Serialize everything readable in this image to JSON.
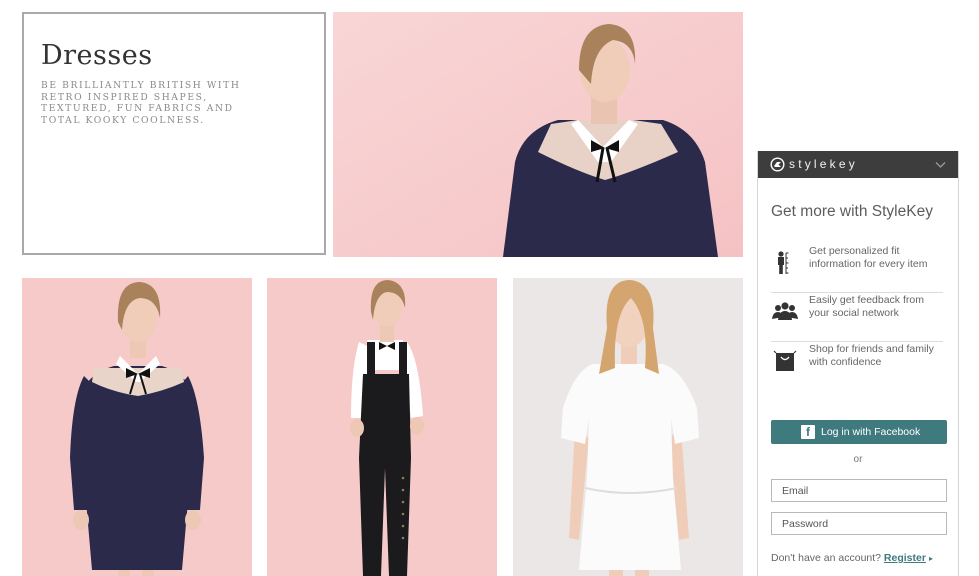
{
  "intro": {
    "title": "Dresses",
    "description": "Be brilliantly British with retro inspired shapes, textured, fun fabrics and total kooky coolness."
  },
  "photos": {
    "hero": "model-navy-dress-lace-yoke",
    "p1": "model-navy-dress-bow",
    "p2": "model-black-dungarees",
    "p3": "model-white-dress"
  },
  "colors": {
    "pink_bg": "#f7c9c9",
    "navy_dress": "#2b2a4a",
    "teal_button": "#3e7a7e",
    "header_dark": "#3d3d3d"
  },
  "stylekey": {
    "brand": "stylekey",
    "title": "Get more with StyleKey",
    "features": [
      {
        "icon": "person-measure-icon",
        "text": "Get personalized fit information for every item"
      },
      {
        "icon": "group-people-icon",
        "text": "Easily get feedback from your social network"
      },
      {
        "icon": "shopping-bag-icon",
        "text": "Shop for friends and family with confidence"
      }
    ],
    "facebook_button": "Log in with Facebook",
    "facebook_icon_letter": "f",
    "or": "or",
    "email_placeholder": "Email",
    "password_placeholder": "Password",
    "no_account": "Don't have an account? ",
    "register": "Register",
    "register_arrow": "▸"
  }
}
